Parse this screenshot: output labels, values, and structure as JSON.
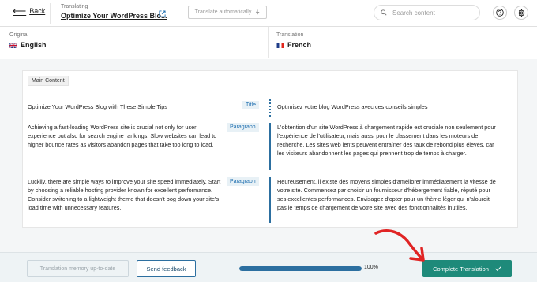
{
  "header": {
    "back_label": "Back",
    "translating_label": "Translating",
    "post_title": "Optimize Your WordPress Blo...",
    "auto_translate_label": "Translate automatically",
    "search_placeholder": "Search content",
    "icons": [
      "arrow-left-icon",
      "external-link-icon",
      "lightning-icon",
      "search-icon",
      "help-icon",
      "gear-icon"
    ]
  },
  "languages": {
    "original_label": "Original",
    "original_name": "English",
    "translation_label": "Translation",
    "translation_name": "French"
  },
  "section": "Main Content",
  "rows": [
    {
      "tag": "Title",
      "source": "Optimize Your WordPress Blog with These Simple Tips",
      "target": "Optimisez votre blog WordPress avec ces conseils simples"
    },
    {
      "tag": "Paragraph",
      "source": "Achieving a fast-loading WordPress site is crucial not only for user experience but also for search engine rankings. Slow websites can lead to higher bounce rates as visitors abandon pages that take too long to load.",
      "target": "L'obtention d'un site WordPress à chargement rapide est cruciale non seulement pour l'expérience de l'utilisateur, mais aussi pour le classement dans les moteurs de recherche. Les sites web lents peuvent entraîner des taux de rebond plus élevés, car les visiteurs abandonnent les pages qui prennent trop de temps à charger."
    },
    {
      "tag": "Paragraph",
      "source": "Luckily, there are simple ways to improve your site speed immediately. Start by choosing a reliable hosting provider known for excellent performance. Consider switching to a lightweight theme that doesn't bog down your site's load time with unnecessary features.",
      "target": "Heureusement, il existe des moyens simples d'améliorer immédiatement la vitesse de votre site. Commencez par choisir un fournisseur d'hébergement fiable, réputé pour ses excellentes performances. Envisagez d'opter pour un thème léger qui n'alourdit pas le temps de chargement de votre site avec des fonctionnalités inutiles."
    }
  ],
  "footer": {
    "memory_label": "Translation memory up-to-date",
    "feedback_label": "Send feedback",
    "progress": 1.0,
    "progress_text": "100%",
    "complete_label": "Complete Translation"
  },
  "colors": {
    "accent": "#2c6fa0",
    "complete": "#1e8a7a",
    "annotation": "#e02424"
  }
}
